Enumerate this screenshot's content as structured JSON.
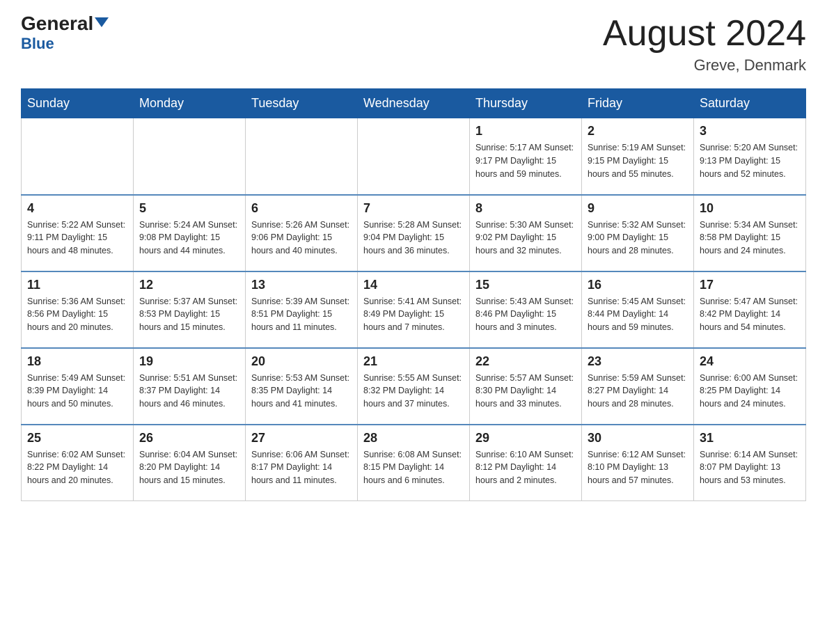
{
  "header": {
    "logo_general": "General",
    "logo_blue": "Blue",
    "month_title": "August 2024",
    "location": "Greve, Denmark"
  },
  "days_of_week": [
    "Sunday",
    "Monday",
    "Tuesday",
    "Wednesday",
    "Thursday",
    "Friday",
    "Saturday"
  ],
  "weeks": [
    [
      {
        "day": "",
        "info": ""
      },
      {
        "day": "",
        "info": ""
      },
      {
        "day": "",
        "info": ""
      },
      {
        "day": "",
        "info": ""
      },
      {
        "day": "1",
        "info": "Sunrise: 5:17 AM\nSunset: 9:17 PM\nDaylight: 15 hours\nand 59 minutes."
      },
      {
        "day": "2",
        "info": "Sunrise: 5:19 AM\nSunset: 9:15 PM\nDaylight: 15 hours\nand 55 minutes."
      },
      {
        "day": "3",
        "info": "Sunrise: 5:20 AM\nSunset: 9:13 PM\nDaylight: 15 hours\nand 52 minutes."
      }
    ],
    [
      {
        "day": "4",
        "info": "Sunrise: 5:22 AM\nSunset: 9:11 PM\nDaylight: 15 hours\nand 48 minutes."
      },
      {
        "day": "5",
        "info": "Sunrise: 5:24 AM\nSunset: 9:08 PM\nDaylight: 15 hours\nand 44 minutes."
      },
      {
        "day": "6",
        "info": "Sunrise: 5:26 AM\nSunset: 9:06 PM\nDaylight: 15 hours\nand 40 minutes."
      },
      {
        "day": "7",
        "info": "Sunrise: 5:28 AM\nSunset: 9:04 PM\nDaylight: 15 hours\nand 36 minutes."
      },
      {
        "day": "8",
        "info": "Sunrise: 5:30 AM\nSunset: 9:02 PM\nDaylight: 15 hours\nand 32 minutes."
      },
      {
        "day": "9",
        "info": "Sunrise: 5:32 AM\nSunset: 9:00 PM\nDaylight: 15 hours\nand 28 minutes."
      },
      {
        "day": "10",
        "info": "Sunrise: 5:34 AM\nSunset: 8:58 PM\nDaylight: 15 hours\nand 24 minutes."
      }
    ],
    [
      {
        "day": "11",
        "info": "Sunrise: 5:36 AM\nSunset: 8:56 PM\nDaylight: 15 hours\nand 20 minutes."
      },
      {
        "day": "12",
        "info": "Sunrise: 5:37 AM\nSunset: 8:53 PM\nDaylight: 15 hours\nand 15 minutes."
      },
      {
        "day": "13",
        "info": "Sunrise: 5:39 AM\nSunset: 8:51 PM\nDaylight: 15 hours\nand 11 minutes."
      },
      {
        "day": "14",
        "info": "Sunrise: 5:41 AM\nSunset: 8:49 PM\nDaylight: 15 hours\nand 7 minutes."
      },
      {
        "day": "15",
        "info": "Sunrise: 5:43 AM\nSunset: 8:46 PM\nDaylight: 15 hours\nand 3 minutes."
      },
      {
        "day": "16",
        "info": "Sunrise: 5:45 AM\nSunset: 8:44 PM\nDaylight: 14 hours\nand 59 minutes."
      },
      {
        "day": "17",
        "info": "Sunrise: 5:47 AM\nSunset: 8:42 PM\nDaylight: 14 hours\nand 54 minutes."
      }
    ],
    [
      {
        "day": "18",
        "info": "Sunrise: 5:49 AM\nSunset: 8:39 PM\nDaylight: 14 hours\nand 50 minutes."
      },
      {
        "day": "19",
        "info": "Sunrise: 5:51 AM\nSunset: 8:37 PM\nDaylight: 14 hours\nand 46 minutes."
      },
      {
        "day": "20",
        "info": "Sunrise: 5:53 AM\nSunset: 8:35 PM\nDaylight: 14 hours\nand 41 minutes."
      },
      {
        "day": "21",
        "info": "Sunrise: 5:55 AM\nSunset: 8:32 PM\nDaylight: 14 hours\nand 37 minutes."
      },
      {
        "day": "22",
        "info": "Sunrise: 5:57 AM\nSunset: 8:30 PM\nDaylight: 14 hours\nand 33 minutes."
      },
      {
        "day": "23",
        "info": "Sunrise: 5:59 AM\nSunset: 8:27 PM\nDaylight: 14 hours\nand 28 minutes."
      },
      {
        "day": "24",
        "info": "Sunrise: 6:00 AM\nSunset: 8:25 PM\nDaylight: 14 hours\nand 24 minutes."
      }
    ],
    [
      {
        "day": "25",
        "info": "Sunrise: 6:02 AM\nSunset: 8:22 PM\nDaylight: 14 hours\nand 20 minutes."
      },
      {
        "day": "26",
        "info": "Sunrise: 6:04 AM\nSunset: 8:20 PM\nDaylight: 14 hours\nand 15 minutes."
      },
      {
        "day": "27",
        "info": "Sunrise: 6:06 AM\nSunset: 8:17 PM\nDaylight: 14 hours\nand 11 minutes."
      },
      {
        "day": "28",
        "info": "Sunrise: 6:08 AM\nSunset: 8:15 PM\nDaylight: 14 hours\nand 6 minutes."
      },
      {
        "day": "29",
        "info": "Sunrise: 6:10 AM\nSunset: 8:12 PM\nDaylight: 14 hours\nand 2 minutes."
      },
      {
        "day": "30",
        "info": "Sunrise: 6:12 AM\nSunset: 8:10 PM\nDaylight: 13 hours\nand 57 minutes."
      },
      {
        "day": "31",
        "info": "Sunrise: 6:14 AM\nSunset: 8:07 PM\nDaylight: 13 hours\nand 53 minutes."
      }
    ]
  ]
}
